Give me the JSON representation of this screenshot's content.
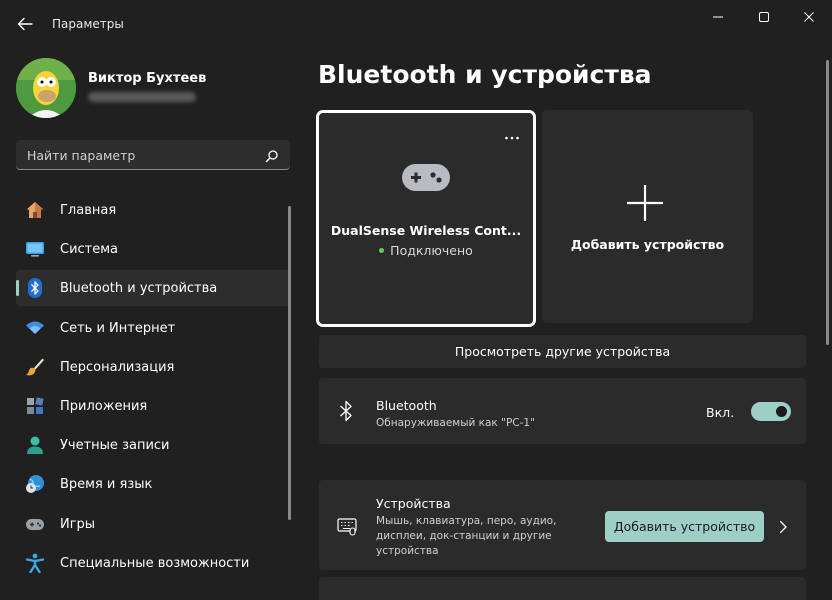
{
  "window": {
    "title": "Параметры"
  },
  "profile": {
    "name": "Виктор Бухтеев"
  },
  "search": {
    "placeholder": "Найти параметр"
  },
  "sidebar": {
    "items": [
      {
        "label": "Главная",
        "icon": "home-icon"
      },
      {
        "label": "Система",
        "icon": "system-display-icon"
      },
      {
        "label": "Bluetooth и устройства",
        "icon": "bluetooth-icon",
        "active": true
      },
      {
        "label": "Сеть и Интернет",
        "icon": "wifi-icon"
      },
      {
        "label": "Персонализация",
        "icon": "brush-icon"
      },
      {
        "label": "Приложения",
        "icon": "apps-icon"
      },
      {
        "label": "Учетные записи",
        "icon": "account-icon"
      },
      {
        "label": "Время и язык",
        "icon": "globe-clock-icon"
      },
      {
        "label": "Игры",
        "icon": "gamepad-icon"
      },
      {
        "label": "Специальные возможности",
        "icon": "accessibility-icon"
      }
    ]
  },
  "main": {
    "page_title": "Bluetooth и устройства",
    "device_card": {
      "name": "DualSense Wireless Cont...",
      "status": "Подключено",
      "more": "..."
    },
    "add_card": {
      "label": "Добавить устройство"
    },
    "view_more": "Просмотреть другие устройства",
    "bluetooth": {
      "title": "Bluetooth",
      "subtitle": "Обнаруживаемый как \"PC-1\"",
      "toggle_label": "Вкл.",
      "enabled": true
    },
    "devices": {
      "title": "Устройства",
      "description": "Мышь, клавиатура, перо, аудио, дисплеи, док-станции и другие устройства",
      "button": "Добавить устройство"
    }
  },
  "colors": {
    "accent": "#9ecfc6",
    "background": "#202020",
    "card": "#2b2b2b",
    "status_connected": "#6ccb5f"
  }
}
